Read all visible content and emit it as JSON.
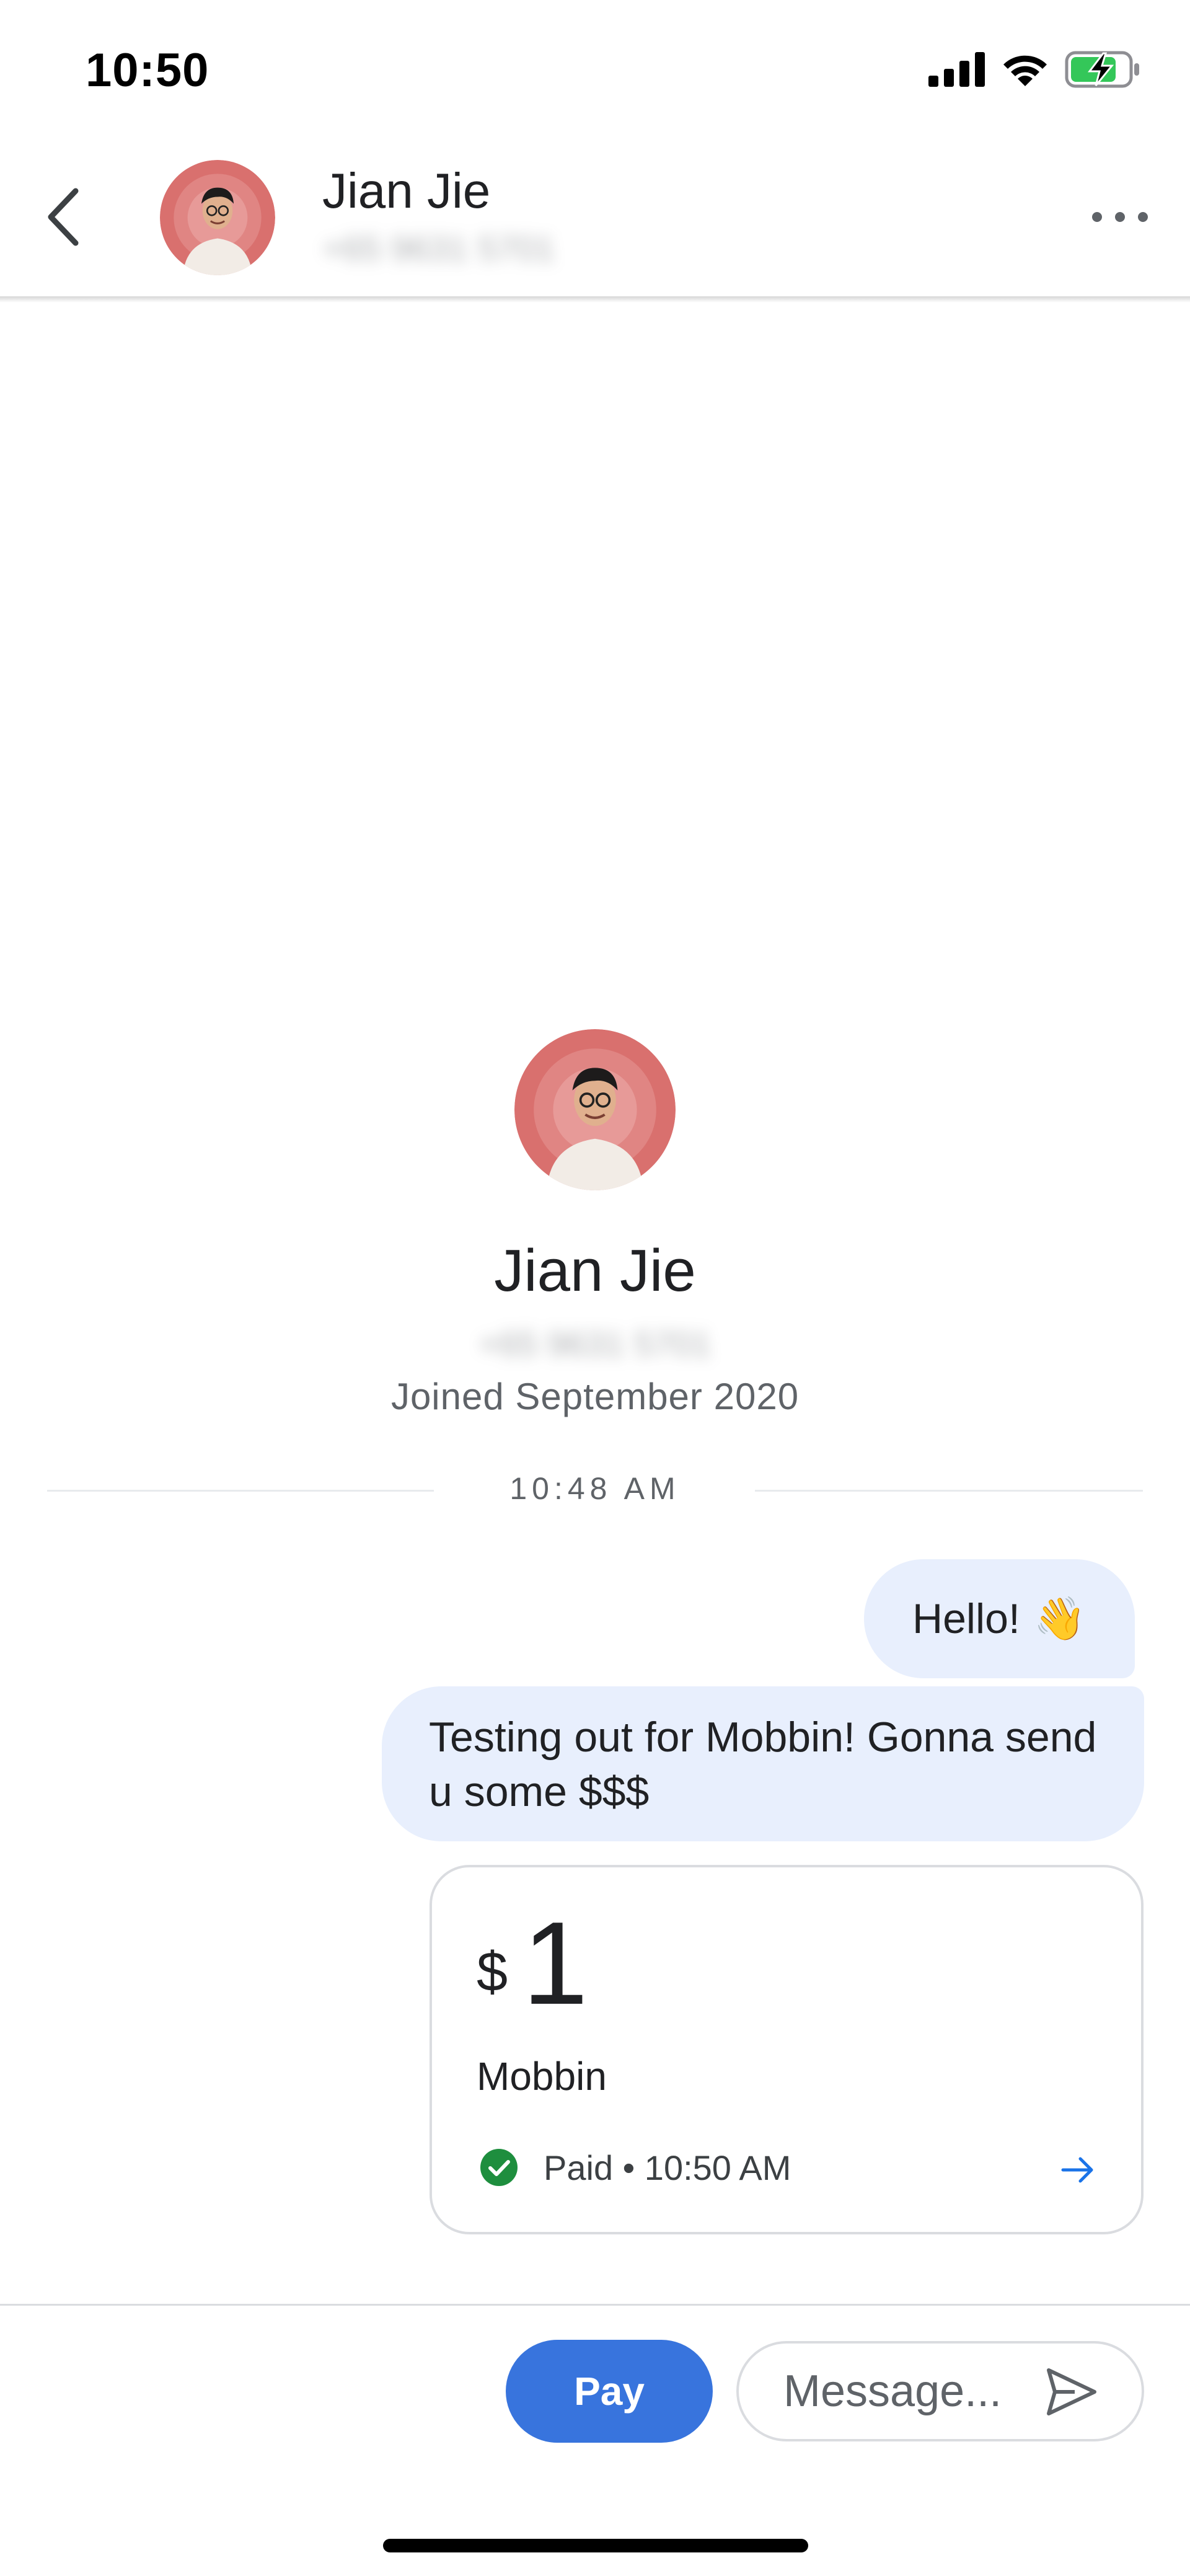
{
  "status_bar": {
    "time": "10:50"
  },
  "header": {
    "contact_name": "Jian Jie",
    "contact_phone": "+65 9631 5701"
  },
  "profile": {
    "name": "Jian Jie",
    "phone": "+65 9631 5701",
    "joined": "Joined September 2020"
  },
  "conversation": {
    "time_divider": "10:48 AM",
    "messages": [
      {
        "text": "Hello!",
        "emoji": "👋"
      },
      {
        "text": "Testing out for Mobbin! Gonna send u some $$$"
      }
    ]
  },
  "payment": {
    "currency": "$",
    "amount": "1",
    "note": "Mobbin",
    "status": "Paid • 10:50 AM",
    "status_icon": "check-circle-icon",
    "status_color": "#1e8e3e"
  },
  "composer": {
    "pay_label": "Pay",
    "message_placeholder": "Message...",
    "accent_color": "#3874dd"
  }
}
